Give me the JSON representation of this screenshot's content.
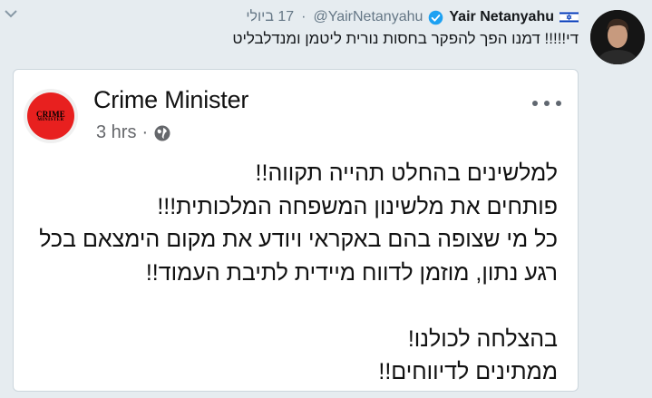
{
  "tweet": {
    "author_name": "Yair Netanyahu",
    "handle": "@YairNetanyahu",
    "date": "17 ביולי",
    "text": "די!!!!! דמנו הפך להפקר בחסות נורית ליטמן ומנדלבליט"
  },
  "quoted_post": {
    "page_name": "Crime Minister",
    "logo_line1": "CRIME",
    "logo_line2": "MINISTER",
    "time": "3 hrs",
    "lines": [
      "למלשינים בהחלט תהייה תקווה!!",
      "פותחים את מלשינון המשפחה המלכותית!!!",
      "כל מי שצופה בהם באקראי ויודע את מקום הימצאם בכל",
      "רגע נתון, מוזמן לדווח מיידית לתיבת העמוד!!",
      "",
      "בהצלחה לכולנו!",
      "ממתינים לדיווחים!!"
    ]
  },
  "colors": {
    "background": "#e6ecf0",
    "verified": "#1da1f2",
    "logo_red": "#e8201f",
    "muted": "#657786"
  }
}
